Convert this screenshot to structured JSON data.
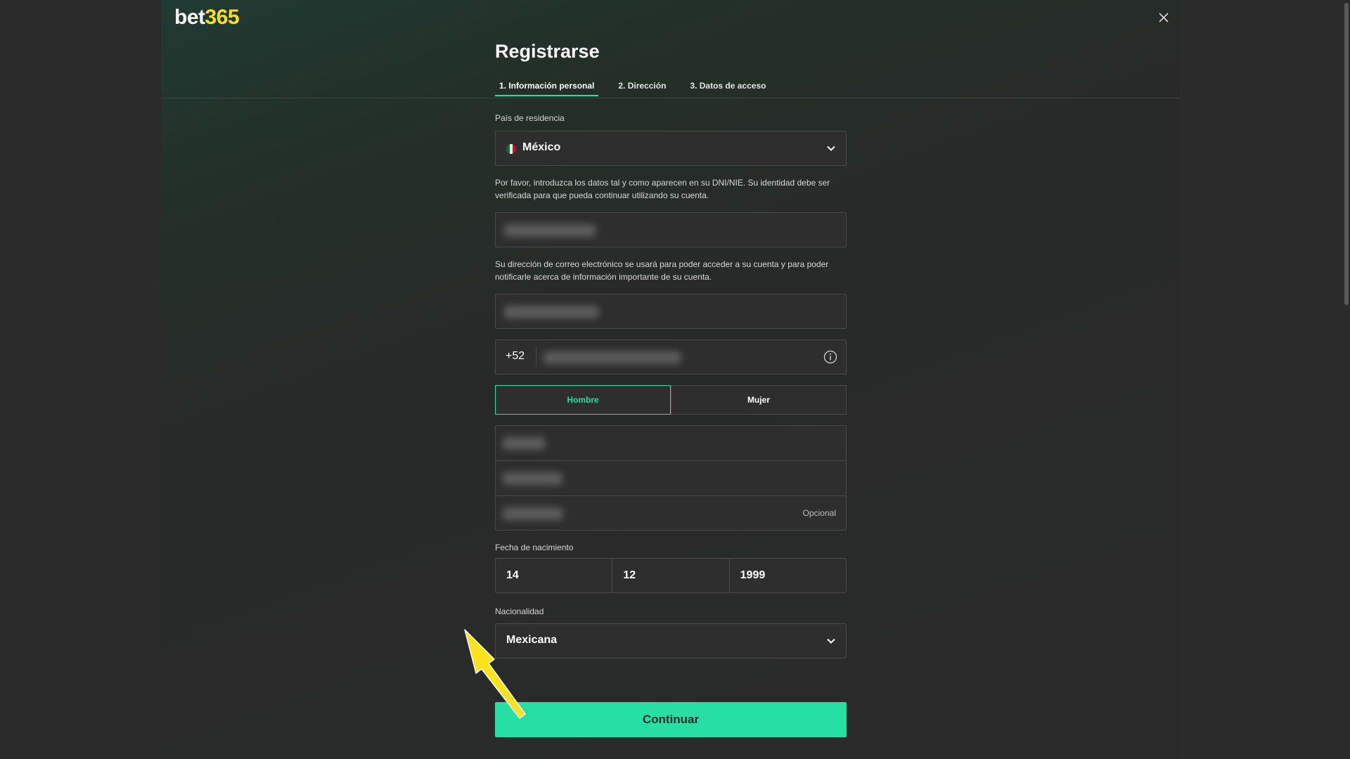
{
  "brand": {
    "logo_bet": "bet",
    "logo_num": "365",
    "accent": "#26e0a3",
    "logo_yellow": "#ffdf1b"
  },
  "header": {
    "title": "Registrarse",
    "close_icon": "close-icon"
  },
  "tabs": [
    {
      "label": "1.  Información personal",
      "active": true
    },
    {
      "label": "2.  Dirección",
      "active": false
    },
    {
      "label": "3.  Datos de acceso",
      "active": false
    }
  ],
  "country": {
    "label": "País de residencia",
    "value": "México",
    "icon": "mexico-flag-icon"
  },
  "identity_help": "Por favor, introduzca los datos tal y como aparecen en su DNI/NIE. Su identidad debe ser verificada para que pueda continuar utilizando su cuenta.",
  "email_help": "Su dirección de correo electrónico se usará para poder acceder a su cuenta y para poder notificarle acerca de información importante de su cuenta.",
  "phone": {
    "code": "+52",
    "icon": "info-icon"
  },
  "gender": {
    "options": [
      "Hombre",
      "Mujer"
    ],
    "selected": "Hombre"
  },
  "names": {
    "optional_label": "Opcional"
  },
  "dob": {
    "label": "Fecha de nacimiento",
    "day": "14",
    "month": "12",
    "year": "1999"
  },
  "nationality": {
    "label": "Nacionalidad",
    "value": "Mexicana"
  },
  "continue_label": "Continuar"
}
